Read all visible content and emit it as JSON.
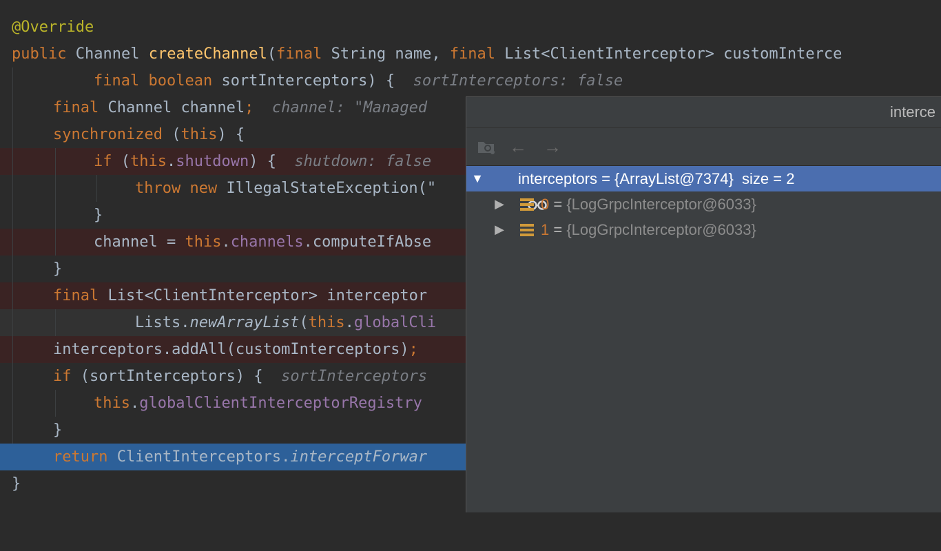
{
  "code": {
    "l1": {
      "t1": "@Override"
    },
    "l2": {
      "t1": "public",
      "t2": " Channel ",
      "t3": "createChannel",
      "t4": "(",
      "t5": "final",
      "t6": " String name, ",
      "t7": "final",
      "t8": " List<ClientInterceptor> customInterce"
    },
    "l3": {
      "t1": "final",
      "t2": " ",
      "t3": "boolean",
      "t4": " sortInterceptors) {  ",
      "hint": "sortInterceptors: false"
    },
    "l4": {
      "t1": "final",
      "t2": " Channel channel",
      "t3": ";",
      "hint": "  channel: \"Managed"
    },
    "l5": {
      "t1": "synchronized",
      "t2": " (",
      "t3": "this",
      "t4": ") {"
    },
    "l6": {
      "t1": "if",
      "t2": " (",
      "t3": "this",
      "t4": ".",
      "t5": "shutdown",
      "t6": ") {  ",
      "hint": "shutdown: false"
    },
    "l7": {
      "t1": "throw",
      "t2": " ",
      "t3": "new",
      "t4": " IllegalStateException(\""
    },
    "l8": {
      "t1": "}"
    },
    "l9": {
      "t1": "channel = ",
      "t2": "this",
      "t3": ".",
      "t4": "channels",
      "t5": ".computeIfAbse"
    },
    "l10": {
      "t1": "}"
    },
    "l11": {
      "t1": "final",
      "t2": " List<ClientInterceptor> interceptor"
    },
    "l12": {
      "t1": "Lists.",
      "t2": "newArrayList",
      "t3": "(",
      "t4": "this",
      "t5": ".",
      "t6": "globalCli"
    },
    "l13": {
      "t1": "interceptors.addAll(customInterceptors)",
      "t2": ";"
    },
    "l14": {
      "t1": "if",
      "t2": " (sortInterceptors) {  ",
      "hint": "sortInterceptors"
    },
    "l15": {
      "t1": "this",
      "t2": ".",
      "t3": "globalClientInterceptorRegistry"
    },
    "l16": {
      "t1": "}"
    },
    "l17": {
      "t1": "return",
      "t2": " ClientInterceptors.",
      "t3": "interceptForwar"
    },
    "l18": {
      "t1": "}"
    }
  },
  "popup": {
    "title": "interce",
    "toolbar": {
      "watch_icon": "watch-folder-icon",
      "back": "←",
      "forward": "→"
    },
    "rows": [
      {
        "arrow": "▼",
        "name": "interceptors",
        "eq": " = ",
        "value": "{ArrayList@7374}",
        "extra": "  size = 2"
      },
      {
        "arrow": "▶",
        "name": "0",
        "eq": " = ",
        "value": "{LogGrpcInterceptor@6033}"
      },
      {
        "arrow": "▶",
        "name": "1",
        "eq": " = ",
        "value": "{LogGrpcInterceptor@6033}"
      }
    ]
  },
  "colors": {
    "background": "#2b2b2b",
    "keyword": "#cc7832",
    "annotation": "#bbb529",
    "method": "#ffc66d",
    "field": "#9876aa",
    "breakpoint_line": "#3a2323",
    "current_line": "#2d6099",
    "selection": "#4b6eaf"
  }
}
